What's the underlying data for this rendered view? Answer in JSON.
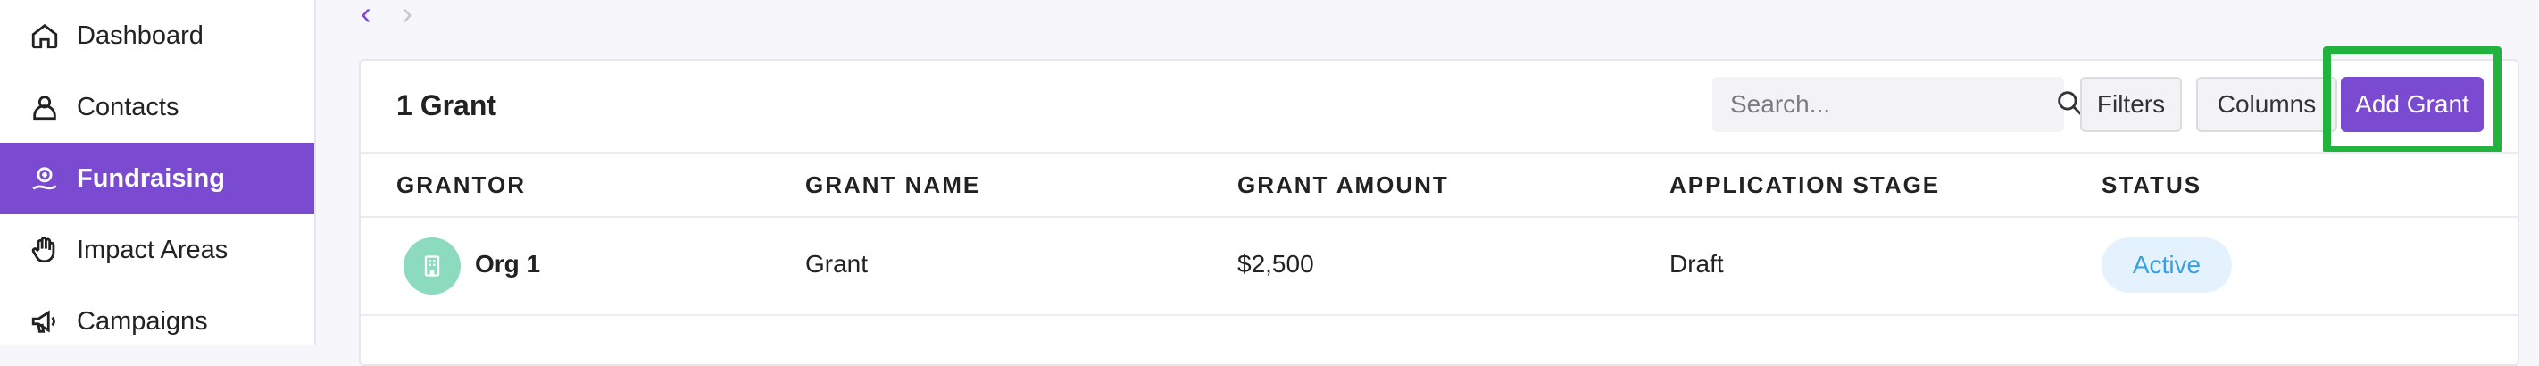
{
  "sidebar": {
    "items": [
      {
        "label": "Dashboard",
        "icon": "home-icon"
      },
      {
        "label": "Contacts",
        "icon": "person-icon"
      },
      {
        "label": "Fundraising",
        "icon": "donation-icon",
        "active": true
      },
      {
        "label": "Impact Areas",
        "icon": "hand-icon"
      },
      {
        "label": "Campaigns",
        "icon": "megaphone-icon"
      }
    ]
  },
  "pager": {
    "prev": "‹",
    "next": "›"
  },
  "card": {
    "title": "1 Grant",
    "search_placeholder": "Search...",
    "filters_label": "Filters",
    "columns_label": "Columns",
    "add_label": "Add Grant"
  },
  "table": {
    "headers": [
      "GRANTOR",
      "GRANT NAME",
      "GRANT AMOUNT",
      "APPLICATION STAGE",
      "STATUS"
    ],
    "rows": [
      {
        "grantor": "Org 1",
        "grant_name": "Grant",
        "amount": "$2,500",
        "stage": "Draft",
        "status": "Active"
      }
    ]
  },
  "colors": {
    "accent": "#7a4bd0",
    "highlight": "#22b33f",
    "status_bg": "#e3f2fd",
    "status_text": "#38a0e0",
    "avatar": "#8ddbbf"
  }
}
